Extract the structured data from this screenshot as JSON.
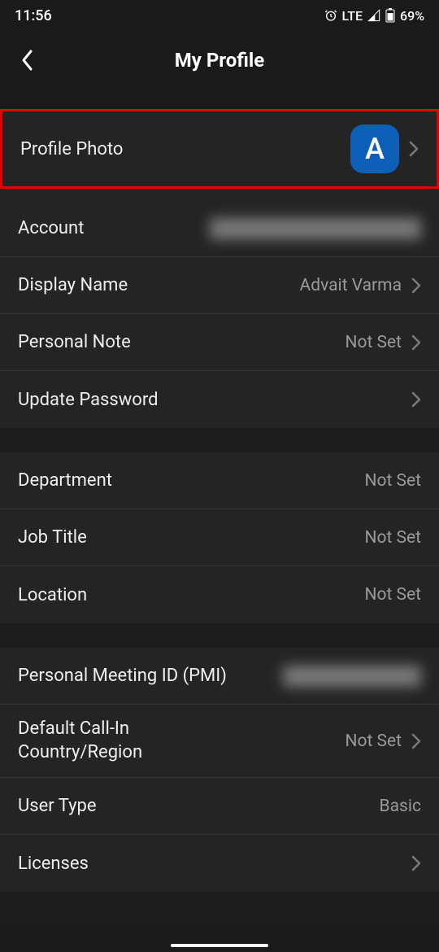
{
  "status": {
    "time": "11:56",
    "network": "LTE",
    "battery": "69%"
  },
  "header": {
    "title": "My Profile"
  },
  "profile": {
    "photo_label": "Profile Photo",
    "avatar_letter": "A",
    "account_label": "Account",
    "display_name_label": "Display Name",
    "display_name_value": "Advait Varma",
    "personal_note_label": "Personal Note",
    "personal_note_value": "Not Set",
    "update_password_label": "Update Password"
  },
  "work": {
    "department_label": "Department",
    "department_value": "Not Set",
    "job_title_label": "Job Title",
    "job_title_value": "Not Set",
    "location_label": "Location",
    "location_value": "Not Set"
  },
  "meeting": {
    "pmi_label": "Personal Meeting ID (PMI)",
    "callin_label": "Default Call-In Country/Region",
    "callin_value": "Not Set",
    "user_type_label": "User Type",
    "user_type_value": "Basic",
    "licenses_label": "Licenses"
  }
}
